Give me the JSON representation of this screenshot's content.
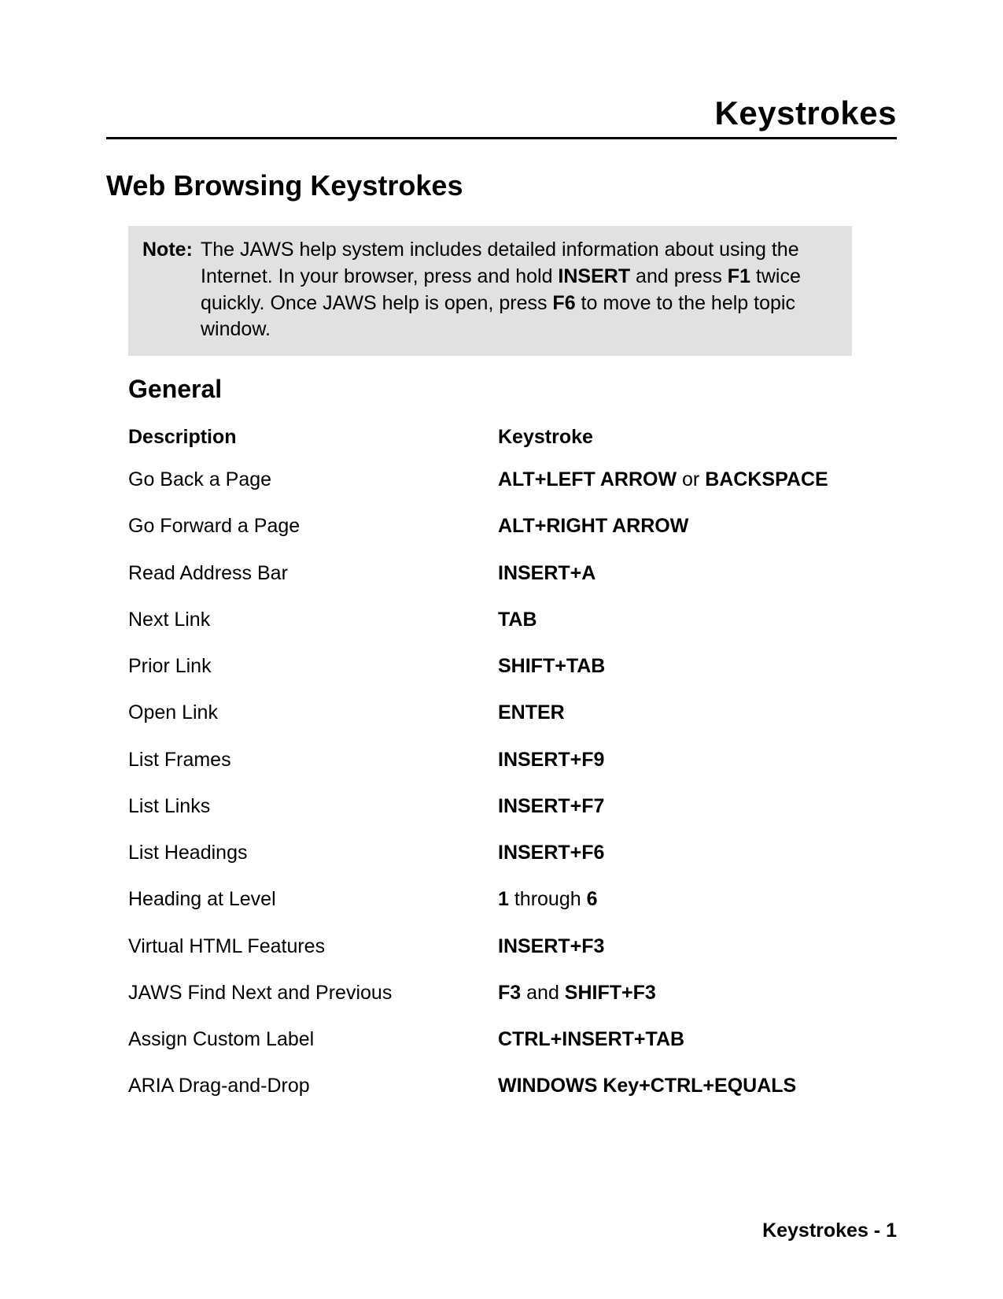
{
  "doc_title": "Keystrokes",
  "section_title": "Web Browsing Keystrokes",
  "note": {
    "label": "Note:",
    "parts": [
      {
        "t": "The JAWS help system includes detailed information about using the Internet. In your browser, press and hold ",
        "b": false
      },
      {
        "t": "INSERT",
        "b": true
      },
      {
        "t": " and press ",
        "b": false
      },
      {
        "t": "F1",
        "b": true
      },
      {
        "t": " twice quickly. Once JAWS help is open, press ",
        "b": false
      },
      {
        "t": "F6",
        "b": true
      },
      {
        "t": " to move to the help topic window.",
        "b": false
      }
    ]
  },
  "subsection_title": "General",
  "headers": {
    "desc": "Description",
    "key": "Keystroke"
  },
  "rows": [
    {
      "desc": "Go Back a Page",
      "key": [
        {
          "t": "ALT+LEFT ARROW",
          "b": true
        },
        {
          "t": " or ",
          "b": false
        },
        {
          "t": "BACKSPACE",
          "b": true
        }
      ]
    },
    {
      "desc": "Go Forward a Page",
      "key": [
        {
          "t": "ALT+RIGHT ARROW",
          "b": true
        }
      ]
    },
    {
      "desc": "Read Address Bar",
      "key": [
        {
          "t": "INSERT+A",
          "b": true
        }
      ]
    },
    {
      "desc": "Next Link",
      "key": [
        {
          "t": "TAB",
          "b": true
        }
      ]
    },
    {
      "desc": "Prior Link",
      "key": [
        {
          "t": "SHIFT+TAB",
          "b": true
        }
      ]
    },
    {
      "desc": "Open Link",
      "key": [
        {
          "t": "ENTER",
          "b": true
        }
      ]
    },
    {
      "desc": "List Frames",
      "key": [
        {
          "t": "INSERT+F9",
          "b": true
        }
      ]
    },
    {
      "desc": "List Links",
      "key": [
        {
          "t": "INSERT+F7",
          "b": true
        }
      ]
    },
    {
      "desc": "List Headings",
      "key": [
        {
          "t": "INSERT+F6",
          "b": true
        }
      ]
    },
    {
      "desc": "Heading at Level",
      "key": [
        {
          "t": "1",
          "b": true
        },
        {
          "t": " through ",
          "b": false
        },
        {
          "t": "6",
          "b": true
        }
      ]
    },
    {
      "desc": "Virtual HTML Features",
      "key": [
        {
          "t": "INSERT+F3",
          "b": true
        }
      ]
    },
    {
      "desc": "JAWS Find Next and Previous",
      "key": [
        {
          "t": "F3",
          "b": true
        },
        {
          "t": " and ",
          "b": false
        },
        {
          "t": "SHIFT+F3",
          "b": true
        }
      ]
    },
    {
      "desc": "Assign Custom Label",
      "key": [
        {
          "t": "CTRL+INSERT+TAB",
          "b": true
        }
      ]
    },
    {
      "desc": "ARIA Drag-and-Drop",
      "key": [
        {
          "t": "WINDOWS Key+CTRL+EQUALS",
          "b": true
        }
      ]
    }
  ],
  "footer": "Keystrokes - 1"
}
